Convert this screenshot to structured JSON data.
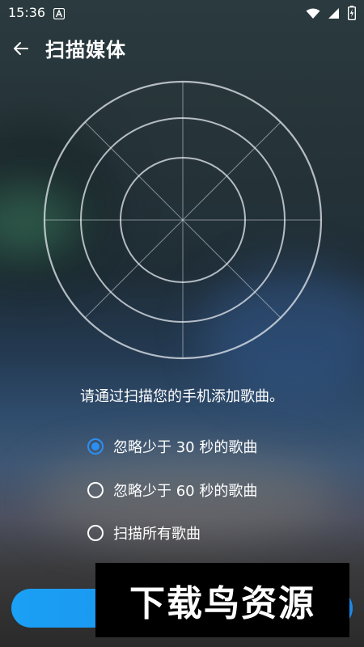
{
  "status_bar": {
    "time": "15:36",
    "notification_icon": "a-letter-icon",
    "wifi_icon": "wifi-icon",
    "signal_icon": "cell-signal-icon",
    "battery_icon": "battery-charging-icon"
  },
  "app_bar": {
    "back_icon": "arrow-left-icon",
    "title": "扫描媒体"
  },
  "radar": {
    "icon": "radar-scanner-icon"
  },
  "main": {
    "description": "请通过扫描您的手机添加歌曲。",
    "options": [
      {
        "label": "忽略少于 30 秒的歌曲",
        "checked": true
      },
      {
        "label": "忽略少于 60 秒的歌曲",
        "checked": false
      },
      {
        "label": "扫描所有歌曲",
        "checked": false
      }
    ]
  },
  "colors": {
    "accent": "#2b8ff2",
    "button": "#1e88e5",
    "text": "#ffffff"
  },
  "watermark": {
    "text": "下载鸟资源"
  }
}
